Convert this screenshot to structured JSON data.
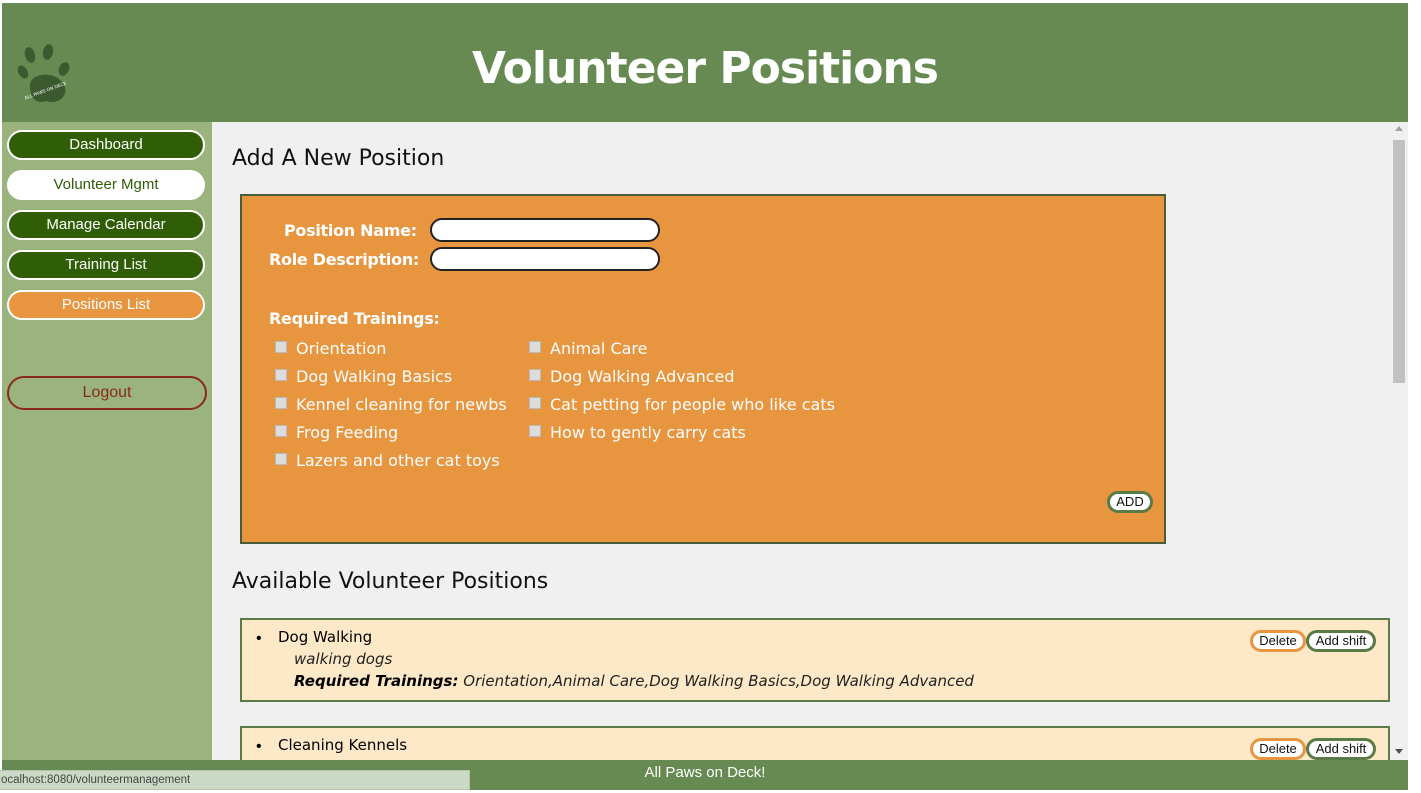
{
  "header": {
    "title": "Volunteer Positions",
    "logo_icon": "paw-icon",
    "logo_text": "ALL PAWS ON DECK",
    "color": "#668a52"
  },
  "sidebar": {
    "items": [
      {
        "label": "Dashboard"
      },
      {
        "label": "Volunteer Mgmt"
      },
      {
        "label": "Manage Calendar"
      },
      {
        "label": "Training List"
      },
      {
        "label": "Positions List"
      }
    ],
    "logout_label": "Logout"
  },
  "add_form": {
    "title": "Add A New Position",
    "position_name_label": "Position Name:",
    "position_name_value": "",
    "role_description_label": "Role Description:",
    "role_description_value": "",
    "required_trainings_label": "Required Trainings:",
    "trainings": [
      "Orientation",
      "Animal Care",
      "Dog Walking Basics",
      "Dog Walking Advanced",
      "Kennel cleaning for newbs",
      "Cat petting for people who like cats",
      "Frog Feeding",
      "How to gently carry cats",
      "Lazers and other cat toys"
    ],
    "add_label": "ADD"
  },
  "positions": {
    "title": "Available Volunteer Positions",
    "required_label": "Required Trainings:",
    "delete_label": "Delete",
    "add_shift_label": "Add shift",
    "items": [
      {
        "name": "Dog Walking",
        "description": "walking dogs",
        "trainings": "Orientation,Animal Care,Dog Walking Basics,Dog Walking Advanced"
      },
      {
        "name": "Cleaning Kennels"
      }
    ]
  },
  "footer": {
    "text": "All Paws on Deck!"
  },
  "status_bar": {
    "url": "ocalhost:8080/volunteermanagement"
  }
}
